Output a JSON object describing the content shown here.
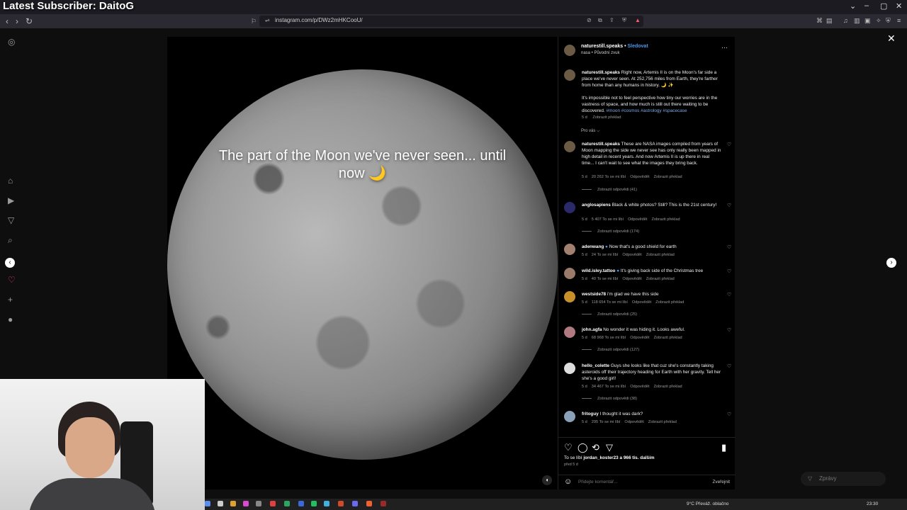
{
  "overlay": {
    "title": "Latest Subscriber: DaitoG"
  },
  "browser": {
    "url": "instagram.com/p/DWz2mHKCooU/",
    "window_controls": [
      "⌄",
      "–",
      "▢",
      "✕"
    ]
  },
  "post": {
    "username": "naturestill.speaks",
    "follow_label": "Sledovat",
    "subline": "nasa • Původní zvuk",
    "media_caption": "The part of the Moon we've never seen... until now 🌙",
    "caption_p1": "Right now, Artemis II is on the Moon's far side a place we've never seen. At 252,756 miles from Earth, they're farther from home than any humans in history. 🌙 ✨",
    "caption_p2": "It's impossible not to feel perspective how tiny our worries are in the vastness of space, and how much is still out there waiting to be discovered.",
    "hashtags": "#moon #cosmos #astrology #spacecase",
    "caption_meta_time": "5 d",
    "caption_meta_translate": "Zobrazit překlad",
    "sort_label": "Pro vás ⌵"
  },
  "comments": [
    {
      "user": "naturestill.speaks",
      "text": "These are NASA images compiled from years of Moon mapping the side we never see has only really been mapped in high detail in recent years. And now Artemis II is up there in real time... I can't wait to see what the images they bring back.",
      "time": "5 d",
      "likes": "20 262 To se mi líbí",
      "reply": "Odpovědět",
      "translate": "Zobrazit překlad",
      "replies": "Zobrazit odpovědi (41)"
    },
    {
      "user": "anglosapiens",
      "text": "Black & white photos? Still? This is the 21st century!",
      "time": "5 d",
      "likes": "5 407 To se mi líbí",
      "reply": "Odpovědět",
      "translate": "Zobrazit překlad",
      "replies": "Zobrazit odpovědi (174)"
    },
    {
      "user": "adenwang",
      "text": "Now that's a good shield for earth",
      "time": "5 d",
      "likes": "24 To se mi líbí",
      "reply": "Odpovědět",
      "translate": "Zobrazit překlad",
      "replies": ""
    },
    {
      "user": "wild.isley.tattoo",
      "text": "It's giving back side of the Christmas tree",
      "time": "5 d",
      "likes": "40 To se mi líbí",
      "reply": "Odpovědět",
      "translate": "Zobrazit překlad",
      "replies": ""
    },
    {
      "user": "westside78",
      "text": "i'm glad we have this side",
      "time": "5 d",
      "likes": "118 654 To se mi líbí",
      "reply": "Odpovědět",
      "translate": "Zobrazit překlad",
      "replies": "Zobrazit odpovědi (25)"
    },
    {
      "user": "john.agfa",
      "text": "No wonder it was hiding it. Looks aweful.",
      "time": "5 d",
      "likes": "68 968 To se mi líbí",
      "reply": "Odpovědět",
      "translate": "Zobrazit překlad",
      "replies": "Zobrazit odpovědi (127)"
    },
    {
      "user": "hello_colette",
      "text": "Guys she looks like that cuz she's constantly taking asteroids off their trajectory heading for Earth with her gravity. Tell her she's a good girl!",
      "time": "5 d",
      "likes": "34 467 To se mi líbí",
      "reply": "Odpovědět",
      "translate": "Zobrazit překlad",
      "replies": "Zobrazit odpovědi (38)"
    },
    {
      "user": "fritoguy",
      "text": "I thought it was dark?",
      "time": "5 d",
      "likes": "295 To se mi líbí",
      "reply": "Odpovědět",
      "translate": "Zobrazit překlad",
      "replies": ""
    }
  ],
  "footer": {
    "likes_prefix": "To se líbí",
    "likes_user": "jordan_koster23",
    "likes_suffix": "a 966 tis. dalším",
    "ago": "před 5 d",
    "comment_placeholder": "Přidejte komentář...",
    "post_label": "Zveřejnit"
  },
  "messages": {
    "label": "Zprávy"
  },
  "tray": {
    "weather": "9°C  Převáž. oblačno",
    "time": "23:30"
  },
  "icons": {
    "close": "✕",
    "prev": "‹",
    "next": "›",
    "heart": "♡",
    "comment": "◯",
    "repost": "⟲",
    "share": "▽",
    "save": "▮",
    "emoji": "☺",
    "more": "···",
    "mute": "🔇"
  },
  "colors": {
    "accent": "#4a9bf0",
    "background": "#000000"
  }
}
